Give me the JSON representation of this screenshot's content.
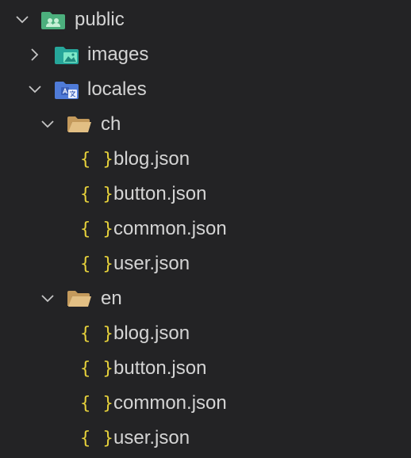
{
  "explorer": {
    "root": {
      "label": "public",
      "icon": "public-folder-icon",
      "expanded": true
    },
    "images": {
      "label": "images",
      "icon": "images-folder-icon",
      "expanded": false
    },
    "locales": {
      "label": "locales",
      "icon": "locales-folder-icon",
      "expanded": true
    },
    "ch": {
      "label": "ch",
      "icon": "folder-open-icon",
      "expanded": true,
      "files": [
        {
          "icon_text": "{ }",
          "label": "blog.json"
        },
        {
          "icon_text": "{ }",
          "label": "button.json"
        },
        {
          "icon_text": "{ }",
          "label": "common.json"
        },
        {
          "icon_text": "{ }",
          "label": "user.json"
        }
      ]
    },
    "en": {
      "label": "en",
      "icon": "folder-open-icon",
      "expanded": true,
      "files": [
        {
          "icon_text": "{ }",
          "label": "blog.json"
        },
        {
          "icon_text": "{ }",
          "label": "button.json"
        },
        {
          "icon_text": "{ }",
          "label": "common.json"
        },
        {
          "icon_text": "{ }",
          "label": "user.json"
        }
      ]
    }
  },
  "colors": {
    "background": "#232325",
    "text": "#d4d4d4",
    "chevron": "#c5c5c5",
    "json_icon": "#e6d13b",
    "folder": "#d9b77e",
    "public_folder": "#4caf7d",
    "images_folder": "#26a69a",
    "locales_folder": "#4f7bd8"
  }
}
